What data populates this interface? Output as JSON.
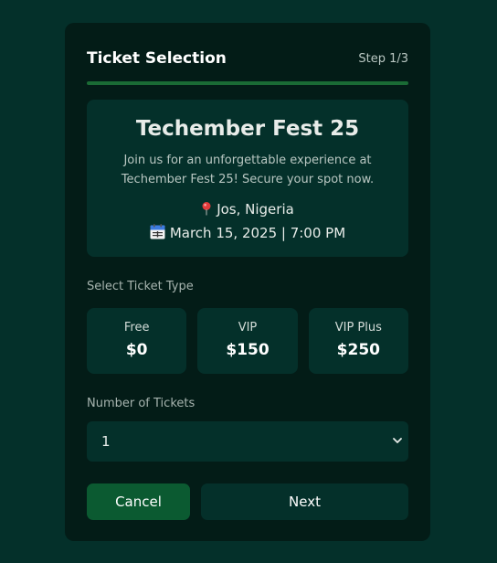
{
  "header": {
    "title": "Ticket Selection",
    "step": "Step 1/3",
    "progress": 1.0
  },
  "event": {
    "name": "Techember Fest 25",
    "description": "Join us for an unforgettable experience at Techember Fest 25! Secure your spot now.",
    "location": "Jos, Nigeria",
    "location_icon": "pin-icon",
    "datetime": "March 15, 2025 | 7:00 PM",
    "date_icon": "calendar-icon"
  },
  "ticket_types": {
    "label": "Select Ticket Type",
    "options": [
      {
        "name": "Free",
        "price": "$0"
      },
      {
        "name": "VIP",
        "price": "$150"
      },
      {
        "name": "VIP Plus",
        "price": "$250"
      }
    ]
  },
  "quantity": {
    "label": "Number of Tickets",
    "value": "1"
  },
  "buttons": {
    "cancel": "Cancel",
    "next": "Next"
  },
  "colors": {
    "background": "#04302a",
    "card": "#031c17",
    "accent": "#0b5a31",
    "progress": "#1a6b35"
  }
}
